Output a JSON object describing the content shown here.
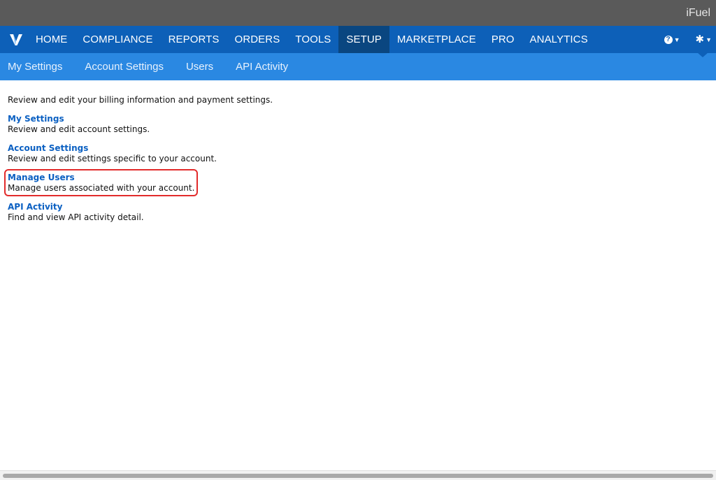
{
  "window": {
    "brand": "iFuel"
  },
  "nav": {
    "logo_icon": "v-logo-icon",
    "items": [
      "HOME",
      "COMPLIANCE",
      "REPORTS",
      "ORDERS",
      "TOOLS",
      "SETUP",
      "MARKETPLACE",
      "PRO",
      "ANALYTICS"
    ],
    "active": "SETUP",
    "help_icon": "question-circle-icon",
    "settings_icon": "gear-icon",
    "help_mark": "?",
    "gear_glyph": "✱"
  },
  "subnav": {
    "items": [
      "My Settings",
      "Account Settings",
      "Users",
      "API Activity"
    ]
  },
  "content": {
    "intro": "Review and edit your billing information and payment settings.",
    "sections": [
      {
        "title": "My Settings",
        "desc": "Review and edit account settings."
      },
      {
        "title": "Account Settings",
        "desc": "Review and edit settings specific to your account."
      },
      {
        "title": "Manage Users",
        "desc": "Manage users associated with your account.",
        "highlighted": true
      },
      {
        "title": "API Activity",
        "desc": "Find and view API activity detail."
      }
    ]
  },
  "colors": {
    "nav_bg": "#0d60b8",
    "nav_active": "#0a4680",
    "subnav_bg": "#2a88e2",
    "link": "#0b60c2",
    "highlight": "#e22b2b"
  }
}
